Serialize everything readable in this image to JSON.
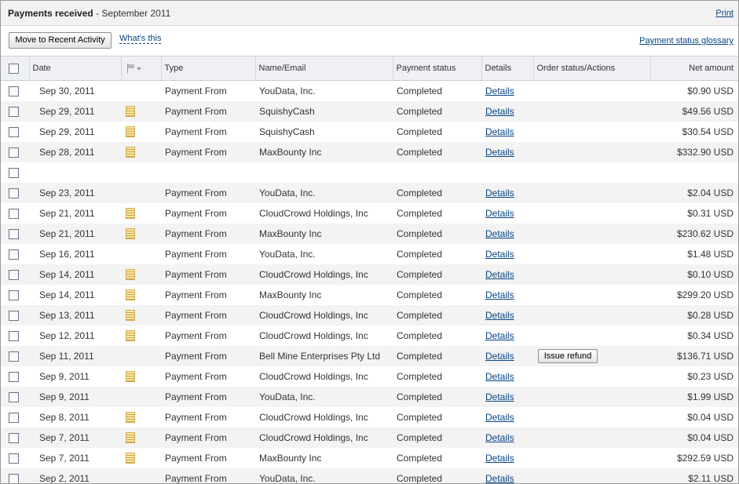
{
  "header": {
    "title_bold": "Payments received",
    "title_rest": " - September 2011",
    "print_label": "Print"
  },
  "toolbar": {
    "move_button_label": "Move to Recent Activity",
    "whats_this_label": "What's this",
    "glossary_label": "Payment status glossary"
  },
  "table": {
    "columns": {
      "date": "Date",
      "type": "Type",
      "name": "Name/Email",
      "status": "Payment status",
      "details": "Details",
      "order": "Order status/Actions",
      "amount": "Net amount"
    },
    "rows": [
      {
        "date": "Sep 30, 2011",
        "note": false,
        "type": "Payment From",
        "name": "YouData, Inc.",
        "status": "Completed",
        "details": "Details",
        "action": "",
        "amount": "$0.90 USD"
      },
      {
        "date": "Sep 29, 2011",
        "note": true,
        "type": "Payment From",
        "name": "SquishyCash",
        "status": "Completed",
        "details": "Details",
        "action": "",
        "amount": "$49.56 USD"
      },
      {
        "date": "Sep 29, 2011",
        "note": true,
        "type": "Payment From",
        "name": "SquishyCash",
        "status": "Completed",
        "details": "Details",
        "action": "",
        "amount": "$30.54 USD"
      },
      {
        "date": "Sep 28, 2011",
        "note": true,
        "type": "Payment From",
        "name": "MaxBounty Inc",
        "status": "Completed",
        "details": "Details",
        "action": "",
        "amount": "$332.90 USD"
      },
      {
        "date": "",
        "note": false,
        "type": "",
        "name": "",
        "status": "",
        "details": "",
        "action": "",
        "amount": ""
      },
      {
        "date": "Sep 23, 2011",
        "note": false,
        "type": "Payment From",
        "name": "YouData, Inc.",
        "status": "Completed",
        "details": "Details",
        "action": "",
        "amount": "$2.04 USD"
      },
      {
        "date": "Sep 21, 2011",
        "note": true,
        "type": "Payment From",
        "name": "CloudCrowd Holdings, Inc",
        "status": "Completed",
        "details": "Details",
        "action": "",
        "amount": "$0.31 USD"
      },
      {
        "date": "Sep 21, 2011",
        "note": true,
        "type": "Payment From",
        "name": "MaxBounty Inc",
        "status": "Completed",
        "details": "Details",
        "action": "",
        "amount": "$230.62 USD"
      },
      {
        "date": "Sep 16, 2011",
        "note": false,
        "type": "Payment From",
        "name": "YouData, Inc.",
        "status": "Completed",
        "details": "Details",
        "action": "",
        "amount": "$1.48 USD"
      },
      {
        "date": "Sep 14, 2011",
        "note": true,
        "type": "Payment From",
        "name": "CloudCrowd Holdings, Inc",
        "status": "Completed",
        "details": "Details",
        "action": "",
        "amount": "$0.10 USD"
      },
      {
        "date": "Sep 14, 2011",
        "note": true,
        "type": "Payment From",
        "name": "MaxBounty Inc",
        "status": "Completed",
        "details": "Details",
        "action": "",
        "amount": "$299.20 USD"
      },
      {
        "date": "Sep 13, 2011",
        "note": true,
        "type": "Payment From",
        "name": "CloudCrowd Holdings, Inc",
        "status": "Completed",
        "details": "Details",
        "action": "",
        "amount": "$0.28 USD"
      },
      {
        "date": "Sep 12, 2011",
        "note": true,
        "type": "Payment From",
        "name": "CloudCrowd Holdings, Inc",
        "status": "Completed",
        "details": "Details",
        "action": "",
        "amount": "$0.34 USD"
      },
      {
        "date": "Sep 11, 2011",
        "note": false,
        "type": "Payment From",
        "name": "Bell Mine Enterprises Pty Ltd",
        "status": "Completed",
        "details": "Details",
        "action": "Issue refund",
        "amount": "$136.71 USD"
      },
      {
        "date": "Sep 9, 2011",
        "note": true,
        "type": "Payment From",
        "name": "CloudCrowd Holdings, Inc",
        "status": "Completed",
        "details": "Details",
        "action": "",
        "amount": "$0.23 USD"
      },
      {
        "date": "Sep 9, 2011",
        "note": false,
        "type": "Payment From",
        "name": "YouData, Inc.",
        "status": "Completed",
        "details": "Details",
        "action": "",
        "amount": "$1.99 USD"
      },
      {
        "date": "Sep 8, 2011",
        "note": true,
        "type": "Payment From",
        "name": "CloudCrowd Holdings, Inc",
        "status": "Completed",
        "details": "Details",
        "action": "",
        "amount": "$0.04 USD"
      },
      {
        "date": "Sep 7, 2011",
        "note": true,
        "type": "Payment From",
        "name": "CloudCrowd Holdings, Inc",
        "status": "Completed",
        "details": "Details",
        "action": "",
        "amount": "$0.04 USD"
      },
      {
        "date": "Sep 7, 2011",
        "note": true,
        "type": "Payment From",
        "name": "MaxBounty Inc",
        "status": "Completed",
        "details": "Details",
        "action": "",
        "amount": "$292.59 USD"
      },
      {
        "date": "Sep 2, 2011",
        "note": false,
        "type": "Payment From",
        "name": "YouData, Inc.",
        "status": "Completed",
        "details": "Details",
        "action": "",
        "amount": "$2.11 USD"
      }
    ]
  },
  "icons": {
    "note": "note-icon",
    "flag": "flag-icon"
  },
  "colors": {
    "link": "#084482",
    "header_bg": "#eef0f3",
    "row_alt_bg": "#f3f3f3"
  }
}
